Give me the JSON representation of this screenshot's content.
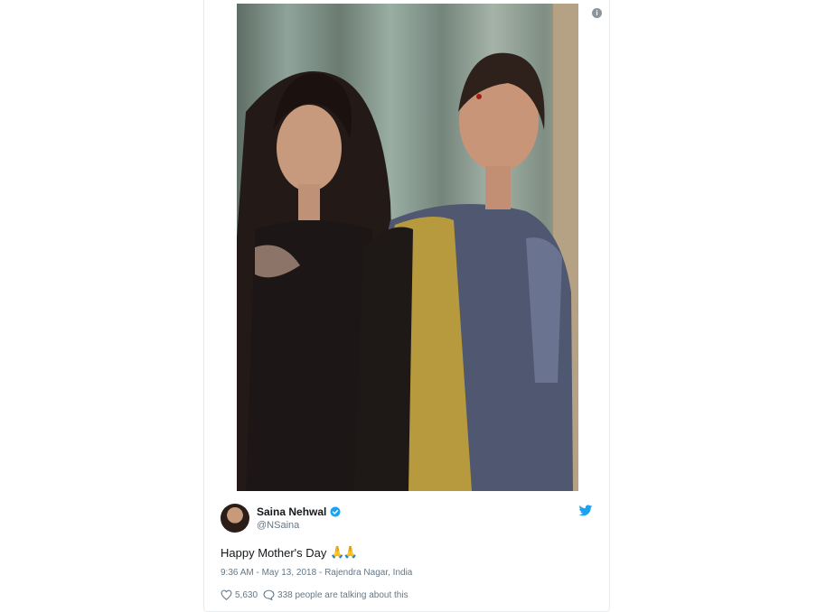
{
  "tweet": {
    "author": {
      "display_name": "Saina Nehwal",
      "handle": "@NSaina",
      "verified": true
    },
    "text": "Happy Mother's Day",
    "emoji": "🙏🙏",
    "timestamp": "9:36 AM - May 13, 2018",
    "location": "Rajendra Nagar, India",
    "meta_separator": " - ",
    "likes": "5,630",
    "conversation": "338 people are talking about this"
  },
  "colors": {
    "twitter_blue": "#1da1f2",
    "text_primary": "#14171a",
    "text_secondary": "#657786"
  },
  "icons": {
    "info": "info-icon",
    "verified": "verified-badge-icon",
    "bird": "twitter-bird-icon",
    "like": "heart-icon",
    "reply": "speech-bubble-icon"
  }
}
